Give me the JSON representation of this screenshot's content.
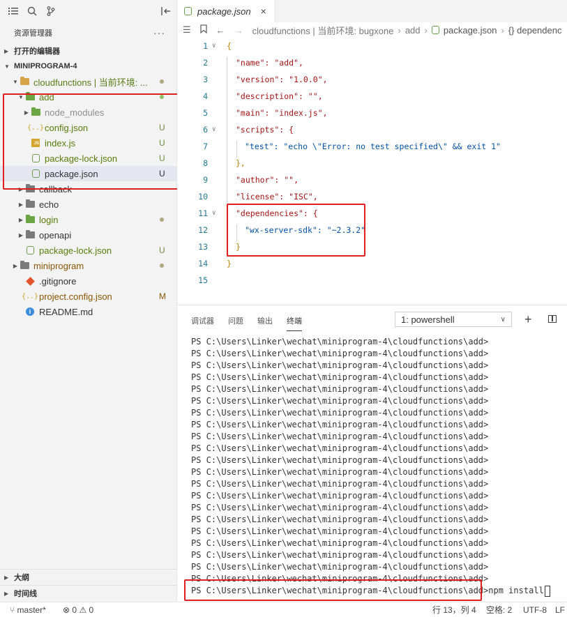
{
  "sidebar": {
    "title": "资源管理器",
    "more": "···",
    "open_editors": "打开的编辑器",
    "workspace": "MINIPROGRAM-4",
    "tree": [
      {
        "label": "cloudfunctions | 当前环境: ...",
        "status": "dot"
      },
      {
        "label": "add",
        "status": "dot"
      },
      {
        "label": "node_modules",
        "status": ""
      },
      {
        "label": "config.json",
        "status": "U"
      },
      {
        "label": "index.js",
        "status": "U"
      },
      {
        "label": "package-lock.json",
        "status": "U"
      },
      {
        "label": "package.json",
        "status": "U"
      },
      {
        "label": "callback",
        "status": ""
      },
      {
        "label": "echo",
        "status": ""
      },
      {
        "label": "login",
        "status": "dot"
      },
      {
        "label": "openapi",
        "status": ""
      },
      {
        "label": "package-lock.json",
        "status": "U"
      },
      {
        "label": "miniprogram",
        "status": "dot"
      },
      {
        "label": ".gitignore",
        "status": ""
      },
      {
        "label": "project.config.json",
        "status": "M"
      },
      {
        "label": "README.md",
        "status": ""
      }
    ],
    "outline": "大纲",
    "timeline": "时间线"
  },
  "editor": {
    "tab": "package.json",
    "close": "×",
    "breadcrumb": [
      "cloudfunctions | 当前环境: bugxone",
      "add",
      "package.json",
      "{} dependenc"
    ],
    "code": [
      {
        "n": "1",
        "text": "{"
      },
      {
        "n": "2",
        "text": "\"name\": \"add\","
      },
      {
        "n": "3",
        "text": "\"version\": \"1.0.0\","
      },
      {
        "n": "4",
        "text": "\"description\": \"\","
      },
      {
        "n": "5",
        "text": "\"main\": \"index.js\","
      },
      {
        "n": "6",
        "text": "\"scripts\": {"
      },
      {
        "n": "7",
        "text": "\"test\": \"echo \\\"Error: no test specified\\\" && exit 1\""
      },
      {
        "n": "8",
        "text": "},"
      },
      {
        "n": "9",
        "text": "\"author\": \"\","
      },
      {
        "n": "10",
        "text": "\"license\": \"ISC\","
      },
      {
        "n": "11",
        "text": "\"dependencies\": {"
      },
      {
        "n": "12",
        "text": "\"wx-server-sdk\": \"~2.3.2\""
      },
      {
        "n": "13",
        "text": "}"
      },
      {
        "n": "14",
        "text": "}"
      },
      {
        "n": "15",
        "text": ""
      }
    ]
  },
  "panel": {
    "tabs": [
      "调试器",
      "问题",
      "输出",
      "终端"
    ],
    "active_tab": "终端",
    "terminal_select": "1: powershell",
    "prompt": "PS C:\\Users\\Linker\\wechat\\miniprogram-4\\cloudfunctions\\add>",
    "command": "npm install"
  },
  "statusbar": {
    "branch": "master*",
    "errors": "0",
    "warnings": "0",
    "position": "行 13，列 4",
    "spaces": "空格: 2",
    "encoding": "UTF-8",
    "eol": "LF"
  },
  "colors": {
    "annotation_red": "#e02020",
    "untracked_green": "#6c8f3a"
  }
}
